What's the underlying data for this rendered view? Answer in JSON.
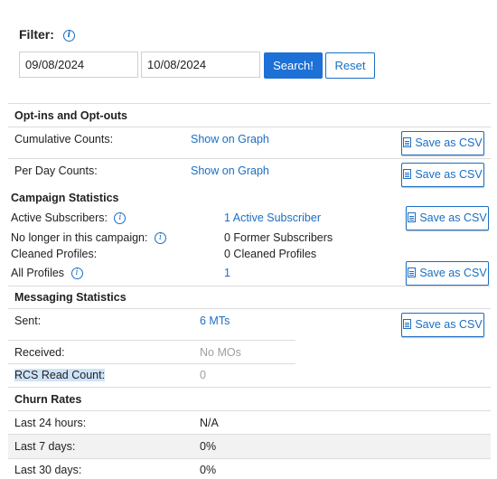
{
  "filter": {
    "label": "Filter:",
    "start_date": "09/08/2024",
    "end_date": "10/08/2024",
    "search_label": "Search!",
    "reset_label": "Reset"
  },
  "optins": {
    "heading": "Opt-ins and Opt-outs",
    "cumulative_label": "Cumulative Counts:",
    "cumulative_link": "Show on Graph",
    "perday_label": "Per Day Counts:",
    "perday_link": "Show on Graph",
    "csv_label": "Save as CSV"
  },
  "campaign": {
    "heading": "Campaign Statistics",
    "active_label": "Active Subscribers:",
    "active_value": "1 Active Subscriber",
    "nolonger_label": "No longer in this campaign:",
    "nolonger_value": "0 Former Subscribers",
    "cleaned_label": "Cleaned Profiles:",
    "cleaned_value": "0 Cleaned Profiles",
    "all_label": "All Profiles",
    "all_value": "1",
    "csv_label": "Save as CSV"
  },
  "messaging": {
    "heading": "Messaging Statistics",
    "sent_label": "Sent:",
    "sent_value": "6 MTs",
    "received_label": "Received:",
    "received_value": "No MOs",
    "rcs_label": "RCS Read Count:",
    "rcs_value": "0",
    "csv_label": "Save as CSV"
  },
  "churn": {
    "heading": "Churn Rates",
    "rows": [
      {
        "label": "Last 24 hours:",
        "value": "N/A"
      },
      {
        "label": "Last 7 days:",
        "value": "0%"
      },
      {
        "label": "Last 30 days:",
        "value": "0%"
      }
    ]
  },
  "icons": {
    "info": "i",
    "colors": {
      "accent": "#1a6fc4",
      "button": "#1d70d6"
    }
  }
}
